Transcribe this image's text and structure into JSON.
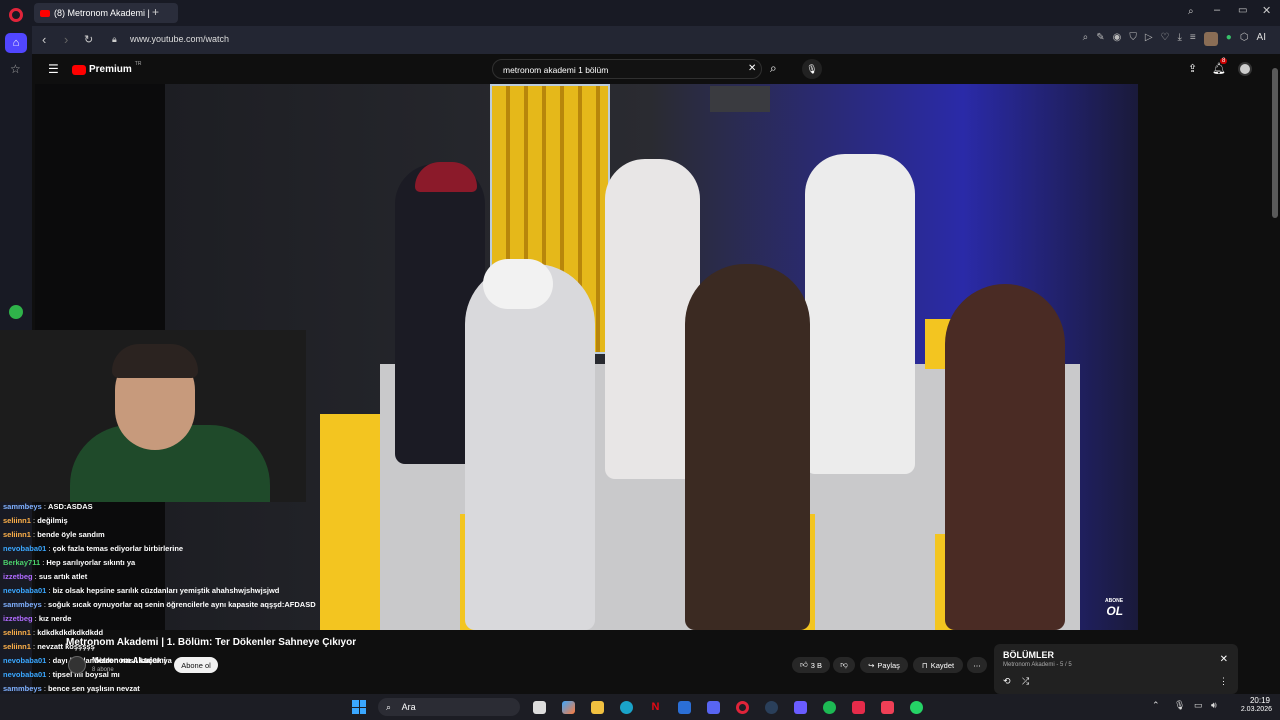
{
  "browser": {
    "tab_title": "(8) Metronom Akademi |",
    "new_tab_label": "+",
    "url": "www.youtube.com/watch",
    "ai_label": "AI"
  },
  "youtube": {
    "logo_text": "Premium",
    "logo_superscript": "TR",
    "search_query": "metronom akademi 1 bölüm",
    "notification_count": "8"
  },
  "video": {
    "watermark_top": "ABONE",
    "watermark_bottom": "OL",
    "title": "Metronom Akademi | 1. Bölüm: Ter Dökenler Sahneye Çıkıyor",
    "channel_name": "Metronom Akademi",
    "subscribers": "8 abone",
    "subscribe_label": "Abone ol",
    "likes": "3 B",
    "share_label": "Paylaş",
    "save_label": "Kaydet"
  },
  "episodes_panel": {
    "heading": "BÖLÜMLER",
    "subtitle": "Metronom Akademi",
    "progress": "5 / 5"
  },
  "chat": [
    {
      "user": "sammbeys",
      "msg": "ASD:ASDAS",
      "color": "#7fb0ff"
    },
    {
      "user": "seliinn1",
      "msg": "değilmiş",
      "color": "#ffb14a"
    },
    {
      "user": "seliinn1",
      "msg": "bende öyle sandım",
      "color": "#ffb14a"
    },
    {
      "user": "nevobaba01",
      "msg": "çok fazla temas ediyorlar birbirlerine",
      "color": "#3aa7ff"
    },
    {
      "user": "Berkay711",
      "msg": "Hep sarılıyorlar sıkıntı ya",
      "color": "#4bd26b"
    },
    {
      "user": "izzetbeg",
      "msg": "sus artık atlet",
      "color": "#b06bff"
    },
    {
      "user": "nevobaba01",
      "msg": "biz olsak hepsine sarılık cüzdanları yemiştik ahahshwjshwjsjwd",
      "color": "#3aa7ff"
    },
    {
      "user": "sammbeys",
      "msg": "soğuk sıcak oynuyorlar aq senin öğrencilerle aynı kapasite aqşşd:AFDASD",
      "color": "#7fb0ff"
    },
    {
      "user": "izzetbeg",
      "msg": "kız nerde",
      "color": "#b06bff"
    },
    {
      "user": "seliinn1",
      "msg": "kdkdkdkdkdkdkdd",
      "color": "#ffb14a"
    },
    {
      "user": "seliinn1",
      "msg": "nevzatt koşşşşş",
      "color": "#ffb14a"
    },
    {
      "user": "nevobaba01",
      "msg": "dayı bunlar bizden nasıl küçük ya",
      "color": "#3aa7ff"
    },
    {
      "user": "nevobaba01",
      "msg": "tipsel mi boysal mı",
      "color": "#3aa7ff"
    },
    {
      "user": "sammbeys",
      "msg": "bence sen yaşlısın nevzat",
      "color": "#7fb0ff"
    }
  ],
  "taskbar": {
    "search_label": "Ara",
    "time": "20:19",
    "date": "2.03.2026"
  }
}
